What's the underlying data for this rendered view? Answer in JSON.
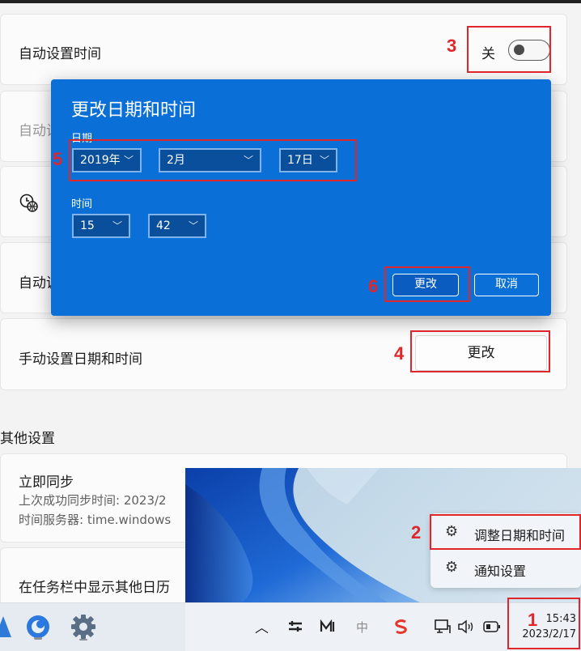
{
  "settings": {
    "auto_time": {
      "label": "自动设置时间",
      "state_label": "关"
    },
    "auto_timezone": {
      "label_partial": "自动设"
    },
    "timezone_row": {
      "icon": "time-zone-globe-icon"
    },
    "auto_dst": {
      "label_partial": "自动调"
    },
    "manual": {
      "label": "手动设置日期和时间",
      "button": "更改"
    },
    "other_section": {
      "title": "其他设置"
    },
    "sync": {
      "title": "立即同步",
      "last_sync": "上次成功同步时间: 2023/2",
      "server": "时间服务器: time.windows"
    },
    "calendar": {
      "label": "在任务栏中显示其他日历"
    }
  },
  "dialog": {
    "title": "更改日期和时间",
    "date_label": "日期",
    "year": "2019年",
    "month": "2月",
    "day": "17日",
    "time_label": "时间",
    "hour": "15",
    "minute": "42",
    "confirm": "更改",
    "cancel": "取消"
  },
  "context_menu": {
    "items": [
      {
        "label": "调整日期和时间",
        "icon": "gear-icon"
      },
      {
        "label": "通知设置",
        "icon": "gear-icon"
      }
    ]
  },
  "taskbar": {
    "time": "15:43",
    "date": "2023/2/17",
    "ime": "中",
    "tray_icons": [
      "chevron-up-icon",
      "pen-icon",
      "app-icon",
      "ime-icon",
      "sogou-icon",
      "network-icon",
      "volume-icon",
      "battery-icon"
    ],
    "pinned_icons": [
      "edge-like-icon",
      "weather-icon",
      "settings-icon"
    ]
  },
  "annotations": [
    "1",
    "2",
    "3",
    "4",
    "5",
    "6"
  ],
  "colors": {
    "dialog_bg": "#0a6fd6",
    "annotation_red": "#e0262a"
  }
}
